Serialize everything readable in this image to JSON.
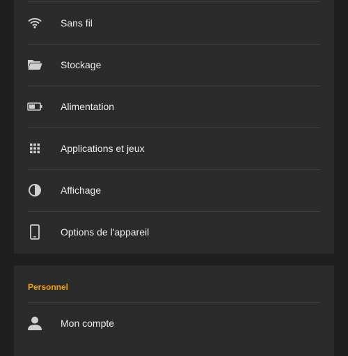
{
  "colors": {
    "background": "#1f1f1f",
    "card": "#2b2b2b",
    "accent": "#f0a30a",
    "divider": "#404040"
  },
  "device_section": {
    "items": [
      {
        "label": "Sans fil",
        "icon": "wifi-icon"
      },
      {
        "label": "Stockage",
        "icon": "folder-icon"
      },
      {
        "label": "Alimentation",
        "icon": "battery-icon"
      },
      {
        "label": "Applications et jeux",
        "icon": "apps-grid-icon"
      },
      {
        "label": "Affichage",
        "icon": "display-contrast-icon"
      },
      {
        "label": "Options de l'appareil",
        "icon": "tablet-icon"
      }
    ]
  },
  "personal_section": {
    "title": "Personnel",
    "items": [
      {
        "label": "Mon compte",
        "icon": "person-icon"
      }
    ]
  }
}
